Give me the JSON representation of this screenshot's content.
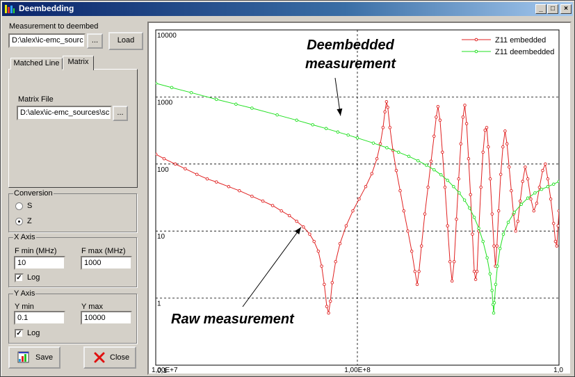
{
  "window": {
    "title": "Deembedding",
    "colors": {
      "titlebar": "#0a246a",
      "face": "#d4d0c8"
    }
  },
  "titlebar_buttons": {
    "minimize": "_",
    "maximize": "□",
    "close": "×"
  },
  "measurement": {
    "label": "Measurement to deembed",
    "path_value": "D:\\alex\\ic-emc_sourc",
    "browse_label": "...",
    "load_label": "Load"
  },
  "tabs": [
    {
      "label": "Matched Line",
      "active": false
    },
    {
      "label": "Matrix",
      "active": true
    }
  ],
  "matrix": {
    "file_label": "Matrix File",
    "file_value": "D:\\alex\\ic-emc_sources\\sc",
    "browse_label": "..."
  },
  "conversion": {
    "title": "Conversion",
    "options": [
      {
        "label": "S",
        "selected": false
      },
      {
        "label": "Z",
        "selected": true
      }
    ]
  },
  "x_axis": {
    "title": "X Axis",
    "fmin_label": "F min (MHz)",
    "fmin_value": "10",
    "fmax_label": "F max (MHz)",
    "fmax_value": "1000",
    "log_label": "Log",
    "log_checked": true
  },
  "y_axis": {
    "title": "Y Axis",
    "ymin_label": "Y min",
    "ymin_value": "0.1",
    "ymax_label": "Y max",
    "ymax_value": "10000",
    "log_label": "Log",
    "log_checked": true
  },
  "buttons": {
    "save_label": "Save",
    "close_label": "Close"
  },
  "check_mark": "✓",
  "chart_data": {
    "type": "line",
    "x_scale": "log",
    "y_scale": "log",
    "xlim": [
      10000000,
      1000000000
    ],
    "ylim": [
      0.1,
      10000
    ],
    "x_tick_labels": [
      {
        "value": 10000000,
        "label": "1,00E+7"
      },
      {
        "value": 100000000,
        "label": "1,00E+8"
      },
      {
        "value": 1000000000,
        "label": "1,0"
      }
    ],
    "y_tick_labels": [
      {
        "value": 10000,
        "label": "10000"
      },
      {
        "value": 1000,
        "label": "1000"
      },
      {
        "value": 100,
        "label": "100"
      },
      {
        "value": 10,
        "label": "10"
      },
      {
        "value": 1,
        "label": "1"
      },
      {
        "value": 0.1,
        "label": "0,1"
      }
    ],
    "grid": true,
    "legend": "top-right",
    "series": [
      {
        "name": "Z11 embedded",
        "color": "#e02020",
        "points": [
          [
            10000000,
            140
          ],
          [
            11000000,
            120
          ],
          [
            12500000,
            100
          ],
          [
            14000000,
            85
          ],
          [
            16000000,
            70
          ],
          [
            18000000,
            60
          ],
          [
            20000000,
            54
          ],
          [
            23000000,
            46
          ],
          [
            26000000,
            40
          ],
          [
            30000000,
            33
          ],
          [
            34000000,
            28
          ],
          [
            38000000,
            24
          ],
          [
            42000000,
            20
          ],
          [
            46000000,
            17
          ],
          [
            50000000,
            14
          ],
          [
            54000000,
            11.5
          ],
          [
            58000000,
            9
          ],
          [
            61000000,
            7
          ],
          [
            64000000,
            5
          ],
          [
            66500000,
            3
          ],
          [
            68500000,
            1.6
          ],
          [
            70500000,
            0.75
          ],
          [
            72000000,
            0.6
          ],
          [
            73500000,
            0.9
          ],
          [
            75000000,
            1.7
          ],
          [
            78000000,
            3.5
          ],
          [
            82000000,
            6.5
          ],
          [
            88000000,
            12
          ],
          [
            95000000,
            20
          ],
          [
            102000000,
            30
          ],
          [
            110000000,
            46
          ],
          [
            118000000,
            72
          ],
          [
            125000000,
            120
          ],
          [
            130000000,
            200
          ],
          [
            134000000,
            350
          ],
          [
            137000000,
            600
          ],
          [
            139500000,
            850
          ],
          [
            141500000,
            700
          ],
          [
            145000000,
            350
          ],
          [
            150000000,
            160
          ],
          [
            156000000,
            80
          ],
          [
            163000000,
            40
          ],
          [
            170000000,
            20
          ],
          [
            178000000,
            10
          ],
          [
            186000000,
            5
          ],
          [
            193000000,
            2.5
          ],
          [
            198000000,
            1.6
          ],
          [
            202000000,
            2.5
          ],
          [
            208000000,
            6
          ],
          [
            216000000,
            18
          ],
          [
            224000000,
            45
          ],
          [
            232000000,
            110
          ],
          [
            240000000,
            260
          ],
          [
            246000000,
            500
          ],
          [
            251000000,
            720
          ],
          [
            257000000,
            450
          ],
          [
            264000000,
            150
          ],
          [
            272000000,
            45
          ],
          [
            280000000,
            12
          ],
          [
            288000000,
            3.5
          ],
          [
            295000000,
            1.8
          ],
          [
            302000000,
            3.5
          ],
          [
            310000000,
            15
          ],
          [
            318000000,
            60
          ],
          [
            326000000,
            200
          ],
          [
            334000000,
            500
          ],
          [
            341000000,
            750
          ],
          [
            348000000,
            400
          ],
          [
            356000000,
            120
          ],
          [
            364000000,
            35
          ],
          [
            372000000,
            9
          ],
          [
            380000000,
            2.5
          ],
          [
            386000000,
            1.9
          ],
          [
            392000000,
            2.5
          ],
          [
            400000000,
            10
          ],
          [
            410000000,
            45
          ],
          [
            420000000,
            150
          ],
          [
            430000000,
            320
          ],
          [
            438000000,
            350
          ],
          [
            446000000,
            180
          ],
          [
            456000000,
            60
          ],
          [
            466000000,
            18
          ],
          [
            476000000,
            6
          ],
          [
            484000000,
            3
          ],
          [
            492000000,
            6
          ],
          [
            502000000,
            20
          ],
          [
            514000000,
            70
          ],
          [
            527000000,
            180
          ],
          [
            540000000,
            310
          ],
          [
            552000000,
            200
          ],
          [
            566000000,
            90
          ],
          [
            580000000,
            40
          ],
          [
            595000000,
            18
          ],
          [
            610000000,
            10
          ],
          [
            625000000,
            14
          ],
          [
            642000000,
            28
          ],
          [
            660000000,
            55
          ],
          [
            680000000,
            90
          ],
          [
            700000000,
            60
          ],
          [
            725000000,
            30
          ],
          [
            750000000,
            20
          ],
          [
            775000000,
            26
          ],
          [
            800000000,
            45
          ],
          [
            830000000,
            80
          ],
          [
            855000000,
            100
          ],
          [
            880000000,
            60
          ],
          [
            910000000,
            30
          ],
          [
            940000000,
            13
          ],
          [
            960000000,
            7
          ],
          [
            975000000,
            6
          ],
          [
            990000000,
            12
          ],
          [
            1000000000,
            20
          ]
        ]
      },
      {
        "name": "Z11 deembedded",
        "color": "#20e020",
        "points": [
          [
            10000000,
            1600
          ],
          [
            12000000,
            1380
          ],
          [
            15000000,
            1160
          ],
          [
            20000000,
            920
          ],
          [
            25000000,
            780
          ],
          [
            30000000,
            680
          ],
          [
            40000000,
            540
          ],
          [
            50000000,
            450
          ],
          [
            60000000,
            385
          ],
          [
            70000000,
            338
          ],
          [
            80000000,
            300
          ],
          [
            90000000,
            270
          ],
          [
            100000000,
            245
          ],
          [
            120000000,
            205
          ],
          [
            140000000,
            175
          ],
          [
            160000000,
            150
          ],
          [
            180000000,
            130
          ],
          [
            200000000,
            112
          ],
          [
            220000000,
            96
          ],
          [
            240000000,
            82
          ],
          [
            260000000,
            69
          ],
          [
            280000000,
            57
          ],
          [
            300000000,
            46
          ],
          [
            320000000,
            37
          ],
          [
            340000000,
            29
          ],
          [
            360000000,
            22
          ],
          [
            380000000,
            16
          ],
          [
            400000000,
            11
          ],
          [
            420000000,
            7
          ],
          [
            440000000,
            4
          ],
          [
            455000000,
            2.3
          ],
          [
            465000000,
            1.3
          ],
          [
            471000000,
            0.8
          ],
          [
            474000000,
            0.6
          ],
          [
            478000000,
            0.85
          ],
          [
            485000000,
            1.6
          ],
          [
            495000000,
            3
          ],
          [
            510000000,
            5.5
          ],
          [
            530000000,
            9
          ],
          [
            560000000,
            13.5
          ],
          [
            600000000,
            19
          ],
          [
            650000000,
            25
          ],
          [
            700000000,
            31
          ],
          [
            760000000,
            37
          ],
          [
            820000000,
            42
          ],
          [
            880000000,
            46
          ],
          [
            940000000,
            50
          ],
          [
            1000000000,
            55
          ]
        ]
      }
    ],
    "annotations": [
      {
        "lines": [
          "Deembedded",
          "measurement"
        ],
        "points_to": [
          135000000,
          1000
        ]
      },
      {
        "lines": [
          "Raw measurement"
        ],
        "points_to": [
          56000000,
          9
        ]
      }
    ]
  }
}
